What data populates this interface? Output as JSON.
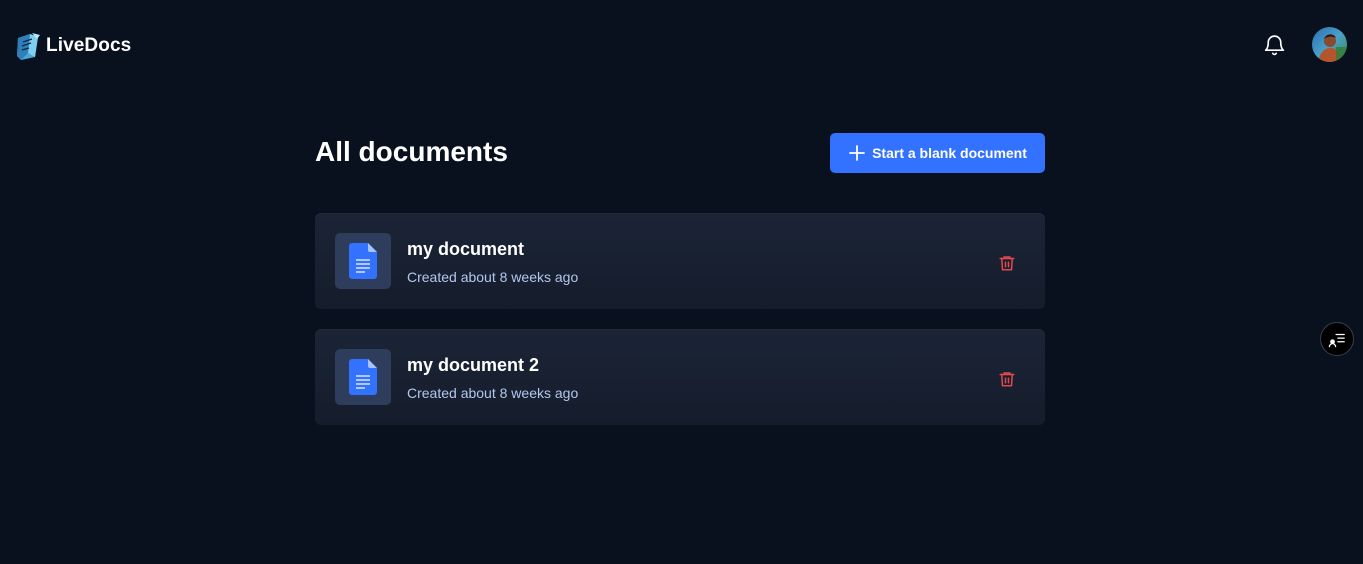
{
  "app": {
    "name": "LiveDocs"
  },
  "header": {
    "logo_icon": "livedocs-logo-icon",
    "notification_icon": "bell-icon",
    "avatar_icon": "user-avatar"
  },
  "main": {
    "title": "All documents",
    "new_document_button": {
      "label": "Start a blank document",
      "icon": "plus-icon",
      "color": "#3371ff"
    },
    "documents": [
      {
        "title": "my document",
        "meta": "Created about 8 weeks ago",
        "icon": "document-icon",
        "action_icon": "trash-icon"
      },
      {
        "title": "my document 2",
        "meta": "Created about 8 weeks ago",
        "icon": "document-icon",
        "action_icon": "trash-icon"
      }
    ]
  },
  "floating": {
    "icon": "user-list-icon"
  },
  "colors": {
    "background": "#09111f",
    "card": "#1b2436",
    "accent": "#3371ff",
    "danger": "#e5484d",
    "muted_text": "#b4c6ee"
  }
}
